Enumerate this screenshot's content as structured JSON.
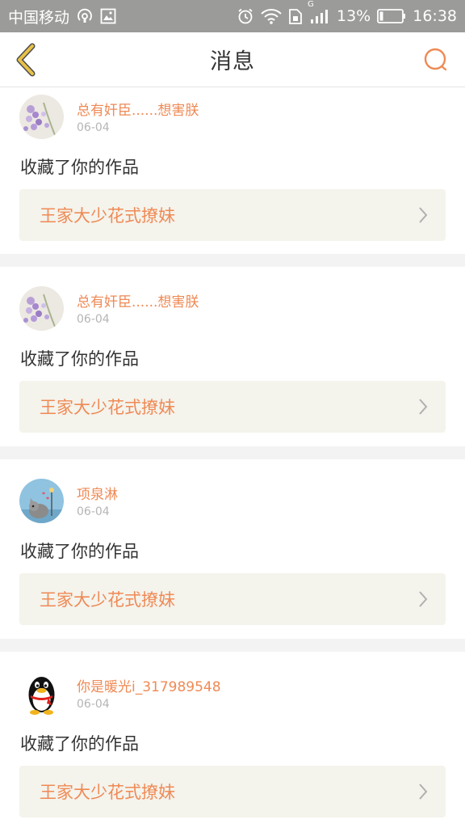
{
  "status_bar": {
    "carrier": "中国移动",
    "battery": "13%",
    "time": "16:38",
    "signal_label": "G"
  },
  "header": {
    "title": "消息"
  },
  "colors": {
    "accent": "#ef8a55",
    "back_icon": "#e8c14a",
    "status_bar_bg": "#9b9b99",
    "link_bg": "#f4f3ec"
  },
  "messages": [
    {
      "user": "总有奸臣......想害朕",
      "date": "06-04",
      "action": "收藏了你的作品",
      "work_title": "王家大少花式撩妹",
      "avatar": "lavender-flower-avatar"
    },
    {
      "user": "总有奸臣......想害朕",
      "date": "06-04",
      "action": "收藏了你的作品",
      "work_title": "王家大少花式撩妹",
      "avatar": "lavender-flower-avatar"
    },
    {
      "user": "项泉淋",
      "date": "06-04",
      "action": "收藏了你的作品",
      "work_title": "王家大少花式撩妹",
      "avatar": "cartoon-cat-avatar"
    },
    {
      "user": "你是暖光i_317989548",
      "date": "06-04",
      "action": "收藏了你的作品",
      "work_title": "王家大少花式撩妹",
      "avatar": "qq-penguin-avatar"
    }
  ]
}
